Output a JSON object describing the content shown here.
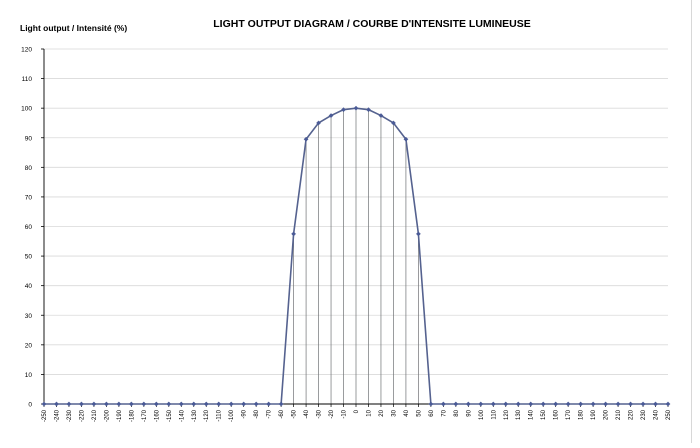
{
  "chart_data": {
    "type": "line",
    "title": "LIGHT OUTPUT DIAGRAM / COURBE D'INTENSITE LUMINEUSE",
    "ylabel": "Light output / Intensité (%)",
    "xlabel": "",
    "ylim": [
      0,
      120
    ],
    "y_ticks": [
      0,
      10,
      20,
      30,
      40,
      50,
      60,
      70,
      80,
      90,
      100,
      110,
      120
    ],
    "x_ticks": [
      -250,
      -240,
      -230,
      -220,
      -210,
      -200,
      -190,
      -180,
      -170,
      -160,
      -150,
      -140,
      -130,
      -120,
      -110,
      -100,
      -90,
      -80,
      -70,
      -60,
      -50,
      -40,
      -30,
      -20,
      -10,
      0,
      10,
      20,
      30,
      40,
      50,
      60,
      70,
      80,
      90,
      100,
      110,
      120,
      130,
      140,
      150,
      160,
      170,
      180,
      190,
      200,
      210,
      220,
      230,
      240,
      250
    ],
    "grid": true,
    "drop_lines": true,
    "series": [
      {
        "x": [
          -250,
          -240,
          -230,
          -220,
          -210,
          -200,
          -190,
          -180,
          -170,
          -160,
          -150,
          -140,
          -130,
          -120,
          -110,
          -100,
          -90,
          -80,
          -70,
          -60,
          -50,
          -40,
          -30,
          -20,
          -10,
          0,
          10,
          20,
          30,
          40,
          50,
          60,
          70,
          80,
          90,
          100,
          110,
          120,
          130,
          140,
          150,
          160,
          170,
          180,
          190,
          200,
          210,
          220,
          230,
          240,
          250
        ],
        "values": [
          0,
          0,
          0,
          0,
          0,
          0,
          0,
          0,
          0,
          0,
          0,
          0,
          0,
          0,
          0,
          0,
          0,
          0,
          0,
          0,
          57.5,
          89.5,
          95,
          97.5,
          99.5,
          100,
          99.5,
          97.5,
          95,
          89.5,
          57.5,
          0,
          0,
          0,
          0,
          0,
          0,
          0,
          0,
          0,
          0,
          0,
          0,
          0,
          0,
          0,
          0,
          0,
          0,
          0,
          0
        ]
      }
    ],
    "colors": {
      "line": "#55628f",
      "marker": "#4a5a96",
      "grid": "#d9d9d9",
      "axis": "#000000",
      "drop_line": "#6f7174"
    }
  }
}
